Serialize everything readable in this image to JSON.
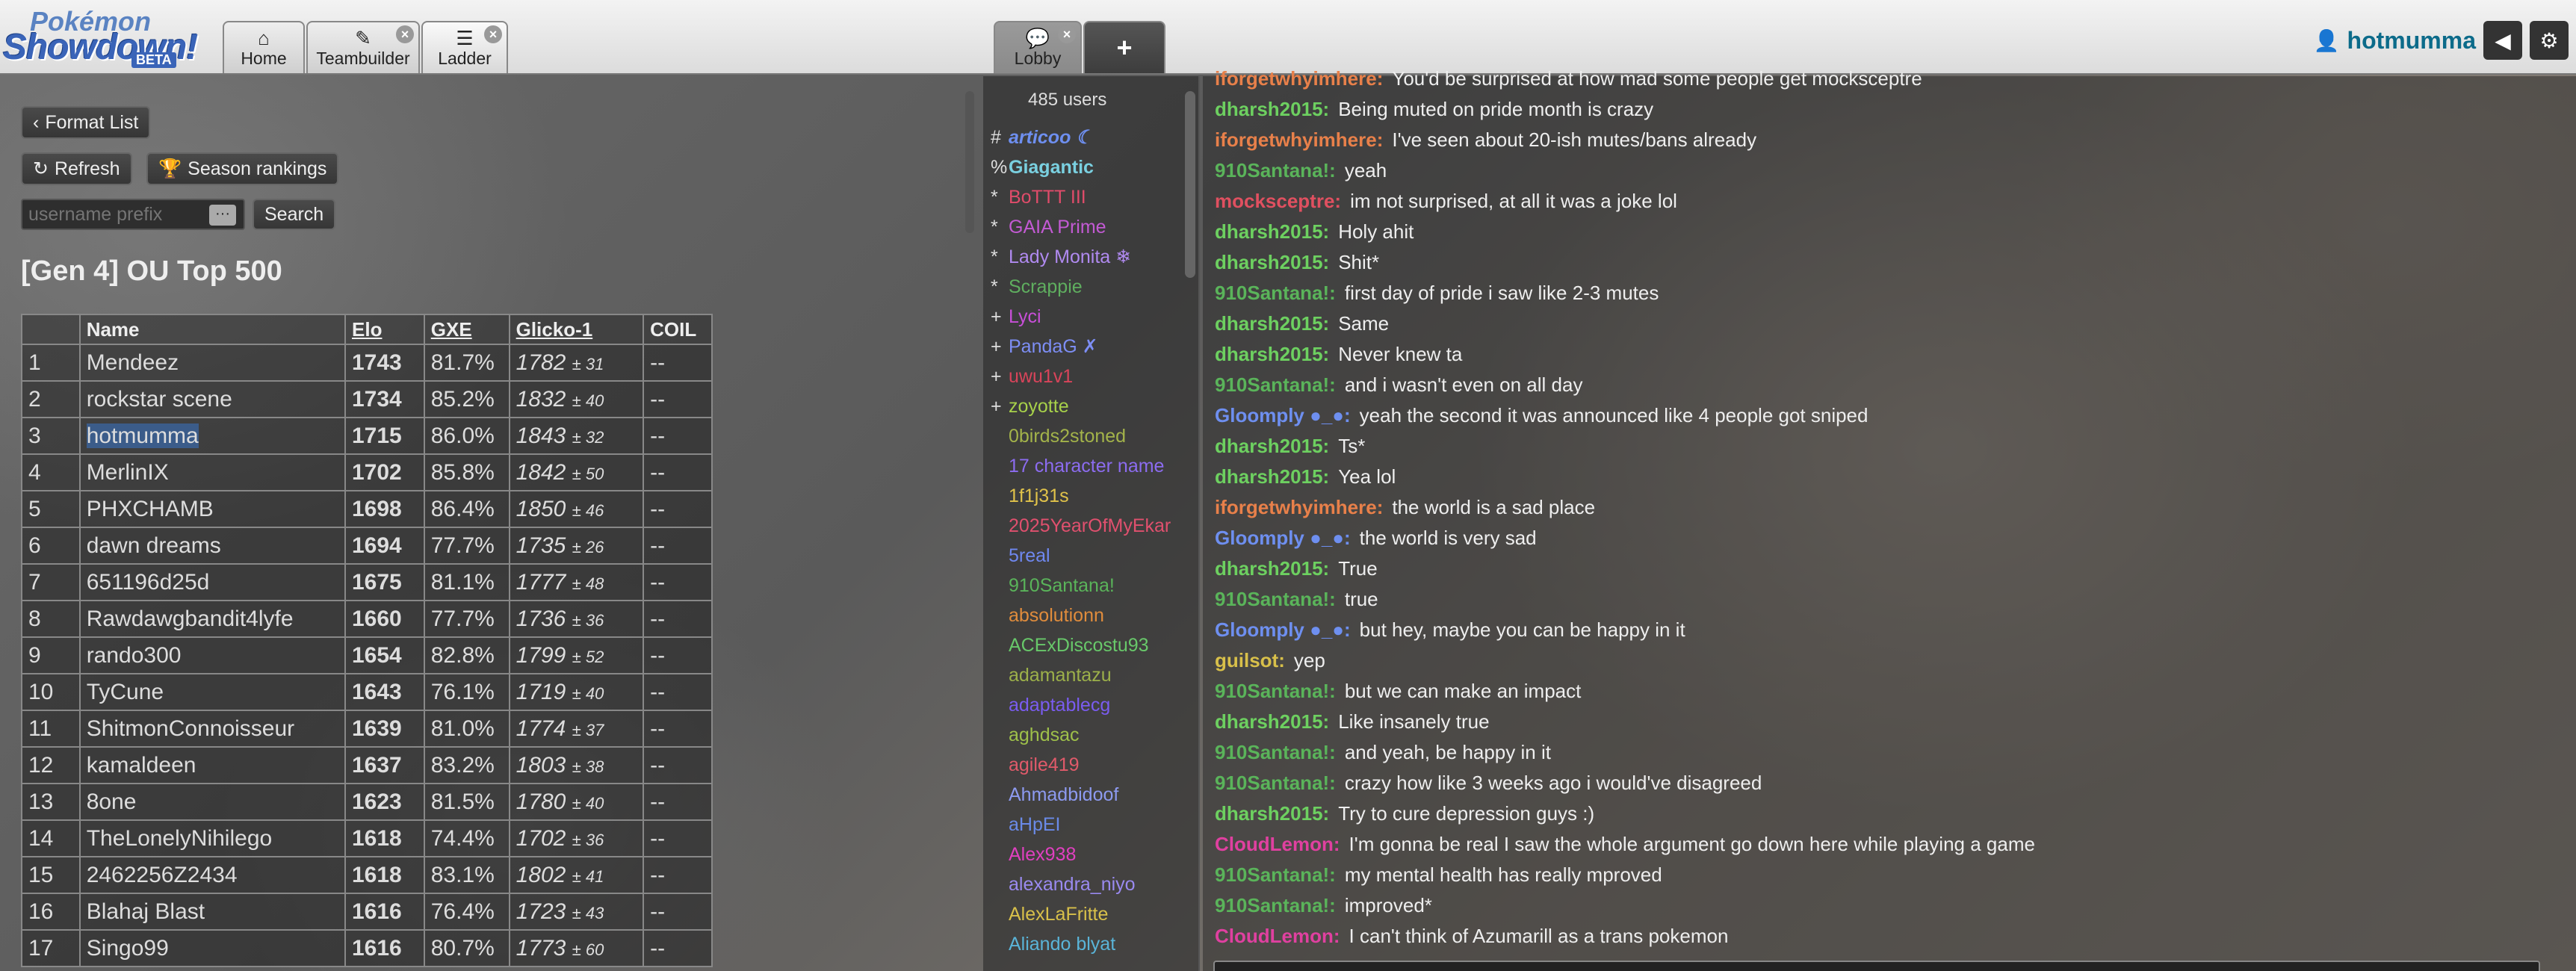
{
  "header": {
    "logo": {
      "line1": "Pokémon",
      "line2": "Showdown!",
      "badge": "BETA"
    },
    "tabs": [
      {
        "label": "Home"
      },
      {
        "label": "Teambuilder"
      },
      {
        "label": "Ladder"
      }
    ],
    "room_tab": {
      "label": "Lobby"
    },
    "add_tab_symbol": "+",
    "username": "hotmumma"
  },
  "ladder": {
    "format_list_label": "Format List",
    "refresh_label": "Refresh",
    "season_label": "Season rankings",
    "search_placeholder": "username prefix",
    "search_label": "Search",
    "title": "[Gen 4] OU Top 500",
    "columns": [
      "",
      "Name",
      "Elo",
      "GXE",
      "Glicko-1",
      "COIL"
    ],
    "rows": [
      {
        "rank": "1",
        "name": "Mendeez",
        "elo": "1743",
        "gxe": "81.7%",
        "glicko": "1782",
        "dev": "± 31",
        "coil": "--"
      },
      {
        "rank": "2",
        "name": "rockstar scene",
        "elo": "1734",
        "gxe": "85.2%",
        "glicko": "1832",
        "dev": "± 40",
        "coil": "--"
      },
      {
        "rank": "3",
        "name": "hotmumma",
        "elo": "1715",
        "gxe": "86.0%",
        "glicko": "1843",
        "dev": "± 32",
        "coil": "--"
      },
      {
        "rank": "4",
        "name": "MerlinIX",
        "elo": "1702",
        "gxe": "85.8%",
        "glicko": "1842",
        "dev": "± 50",
        "coil": "--"
      },
      {
        "rank": "5",
        "name": "PHXCHAMB",
        "elo": "1698",
        "gxe": "86.4%",
        "glicko": "1850",
        "dev": "± 46",
        "coil": "--"
      },
      {
        "rank": "6",
        "name": "dawn dreams",
        "elo": "1694",
        "gxe": "77.7%",
        "glicko": "1735",
        "dev": "± 26",
        "coil": "--"
      },
      {
        "rank": "7",
        "name": "651196d25d",
        "elo": "1675",
        "gxe": "81.1%",
        "glicko": "1777",
        "dev": "± 48",
        "coil": "--"
      },
      {
        "rank": "8",
        "name": "Rawdawgbandit4lyfe",
        "elo": "1660",
        "gxe": "77.7%",
        "glicko": "1736",
        "dev": "± 36",
        "coil": "--"
      },
      {
        "rank": "9",
        "name": "rando300",
        "elo": "1654",
        "gxe": "82.8%",
        "glicko": "1799",
        "dev": "± 52",
        "coil": "--"
      },
      {
        "rank": "10",
        "name": "TyCune",
        "elo": "1643",
        "gxe": "76.1%",
        "glicko": "1719",
        "dev": "± 40",
        "coil": "--"
      },
      {
        "rank": "11",
        "name": "ShitmonConnoisseur",
        "elo": "1639",
        "gxe": "81.0%",
        "glicko": "1774",
        "dev": "± 37",
        "coil": "--"
      },
      {
        "rank": "12",
        "name": "kamaldeen",
        "elo": "1637",
        "gxe": "83.2%",
        "glicko": "1803",
        "dev": "± 38",
        "coil": "--"
      },
      {
        "rank": "13",
        "name": "8one",
        "elo": "1623",
        "gxe": "81.5%",
        "glicko": "1780",
        "dev": "± 40",
        "coil": "--"
      },
      {
        "rank": "14",
        "name": "TheLonelyNihilego",
        "elo": "1618",
        "gxe": "74.4%",
        "glicko": "1702",
        "dev": "± 36",
        "coil": "--"
      },
      {
        "rank": "15",
        "name": "2462256Z2434",
        "elo": "1618",
        "gxe": "83.1%",
        "glicko": "1802",
        "dev": "± 41",
        "coil": "--"
      },
      {
        "rank": "16",
        "name": "Blahaj Blast",
        "elo": "1616",
        "gxe": "76.4%",
        "glicko": "1723",
        "dev": "± 43",
        "coil": "--"
      },
      {
        "rank": "17",
        "name": "Singo99",
        "elo": "1616",
        "gxe": "80.7%",
        "glicko": "1773",
        "dev": "± 60",
        "coil": "--"
      }
    ]
  },
  "userlist": {
    "count": "485 users",
    "users": [
      {
        "rank": "#",
        "name": "articoo ☾",
        "color": "#6e8ff0",
        "style": "bold-italic"
      },
      {
        "rank": "%",
        "name": "Giagantic",
        "color": "#7ad0e0",
        "style": "bold"
      },
      {
        "rank": "*",
        "name": "BoTTT III",
        "color": "#e04c6a",
        "style": ""
      },
      {
        "rank": "*",
        "name": "GAIA Prime",
        "color": "#c35ad4",
        "style": ""
      },
      {
        "rank": "*",
        "name": "Lady Monita ❄",
        "color": "#b08af0",
        "style": ""
      },
      {
        "rank": "*",
        "name": "Scrappie",
        "color": "#5fae5f",
        "style": ""
      },
      {
        "rank": "+",
        "name": "Lyci",
        "color": "#c84fd8",
        "style": ""
      },
      {
        "rank": "+",
        "name": "PandaG ✗",
        "color": "#7d8ef5",
        "style": ""
      },
      {
        "rank": "+",
        "name": "uwu1v1",
        "color": "#d8445a",
        "style": ""
      },
      {
        "rank": "+",
        "name": "zoyotte",
        "color": "#a7d14a",
        "style": ""
      },
      {
        "rank": "",
        "name": "0birds2stoned",
        "color": "#a3b34a",
        "style": ""
      },
      {
        "rank": "",
        "name": "17 character name",
        "color": "#8c6cf0",
        "style": ""
      },
      {
        "rank": "",
        "name": "1f1j31s",
        "color": "#e0c24a",
        "style": ""
      },
      {
        "rank": "",
        "name": "2025YearOfMyEkar",
        "color": "#e0506e",
        "style": ""
      },
      {
        "rank": "",
        "name": "5real",
        "color": "#6f88f0",
        "style": ""
      },
      {
        "rank": "",
        "name": "910Santana!",
        "color": "#5ab45a",
        "style": ""
      },
      {
        "rank": "",
        "name": "absolutionn",
        "color": "#e08c3c",
        "style": ""
      },
      {
        "rank": "",
        "name": "ACExDiscostu93",
        "color": "#68c86a",
        "style": ""
      },
      {
        "rank": "",
        "name": "adamantazu",
        "color": "#9cb04a",
        "style": ""
      },
      {
        "rank": "",
        "name": "adaptablecg",
        "color": "#7a5cf0",
        "style": ""
      },
      {
        "rank": "",
        "name": "aghdsac",
        "color": "#9ec04a",
        "style": ""
      },
      {
        "rank": "",
        "name": "agile419",
        "color": "#e05a6a",
        "style": ""
      },
      {
        "rank": "",
        "name": "Ahmadbidoof",
        "color": "#8d9af0",
        "style": ""
      },
      {
        "rank": "",
        "name": "aHpEI",
        "color": "#6a8ae8",
        "style": ""
      },
      {
        "rank": "",
        "name": "Alex938",
        "color": "#e040c0",
        "style": ""
      },
      {
        "rank": "",
        "name": "alexandra_niyo",
        "color": "#9a8af0",
        "style": ""
      },
      {
        "rank": "",
        "name": "AlexLaFritte",
        "color": "#d8c04a",
        "style": ""
      },
      {
        "rank": "",
        "name": "Aliando blyat",
        "color": "#5ab4d8",
        "style": ""
      }
    ]
  },
  "chat": {
    "messages": [
      {
        "who": "iforgetwhyimhere:",
        "color": "#e8804a",
        "text": "You'd be surprised at how mad some people get mocksceptre"
      },
      {
        "who": "dharsh2015:",
        "color": "#6dd060",
        "text": "Being muted on pride month is crazy"
      },
      {
        "who": "iforgetwhyimhere:",
        "color": "#e8804a",
        "text": "I've seen about 20-ish mutes/bans already"
      },
      {
        "who": "910Santana!:",
        "color": "#5ab45a",
        "text": "yeah"
      },
      {
        "who": "mocksceptre:",
        "color": "#e05060",
        "text": "im not surprised, at all it was a joke lol"
      },
      {
        "who": "dharsh2015:",
        "color": "#6dd060",
        "text": "Holy ahit"
      },
      {
        "who": "dharsh2015:",
        "color": "#6dd060",
        "text": "Shit*"
      },
      {
        "who": "910Santana!:",
        "color": "#5ab45a",
        "text": "first day of pride i saw like 2-3 mutes"
      },
      {
        "who": "dharsh2015:",
        "color": "#6dd060",
        "text": "Same"
      },
      {
        "who": "dharsh2015:",
        "color": "#6dd060",
        "text": "Never knew ta"
      },
      {
        "who": "910Santana!:",
        "color": "#5ab45a",
        "text": "and i wasn't even on all day"
      },
      {
        "who": "Gloomply ●_●:",
        "color": "#6e8ff0",
        "text": "yeah the second it was announced like 4 people got sniped"
      },
      {
        "who": "dharsh2015:",
        "color": "#6dd060",
        "text": "Ts*"
      },
      {
        "who": "dharsh2015:",
        "color": "#6dd060",
        "text": "Yea lol"
      },
      {
        "who": "iforgetwhyimhere:",
        "color": "#e8804a",
        "text": "the world is a sad place"
      },
      {
        "who": "Gloomply ●_●:",
        "color": "#6e8ff0",
        "text": "the world is very sad"
      },
      {
        "who": "dharsh2015:",
        "color": "#6dd060",
        "text": "True"
      },
      {
        "who": "910Santana!:",
        "color": "#5ab45a",
        "text": "true"
      },
      {
        "who": "Gloomply ●_●:",
        "color": "#6e8ff0",
        "text": "but hey, maybe you can be happy in it"
      },
      {
        "who": "guilsot:",
        "color": "#d8c04a",
        "text": "yep"
      },
      {
        "who": "910Santana!:",
        "color": "#5ab45a",
        "text": "but we can make an impact"
      },
      {
        "who": "dharsh2015:",
        "color": "#6dd060",
        "text": "Like insanely true"
      },
      {
        "who": "910Santana!:",
        "color": "#5ab45a",
        "text": "and yeah, be happy in it"
      },
      {
        "who": "910Santana!:",
        "color": "#5ab45a",
        "text": "crazy how like 3 weeks ago i would've disagreed"
      },
      {
        "who": "dharsh2015:",
        "color": "#6dd060",
        "text": "Try to cure depression guys :)"
      },
      {
        "who": "CloudLemon:",
        "color": "#e040a0",
        "text": "I'm gonna be real I saw the whole argument go down here while playing a game"
      },
      {
        "who": "910Santana!:",
        "color": "#5ab45a",
        "text": "my mental health has really mproved"
      },
      {
        "who": "910Santana!:",
        "color": "#5ab45a",
        "text": "improved*"
      },
      {
        "who": "CloudLemon:",
        "color": "#e040a0",
        "text": "I can't think of Azumarill as a trans pokemon"
      }
    ]
  }
}
